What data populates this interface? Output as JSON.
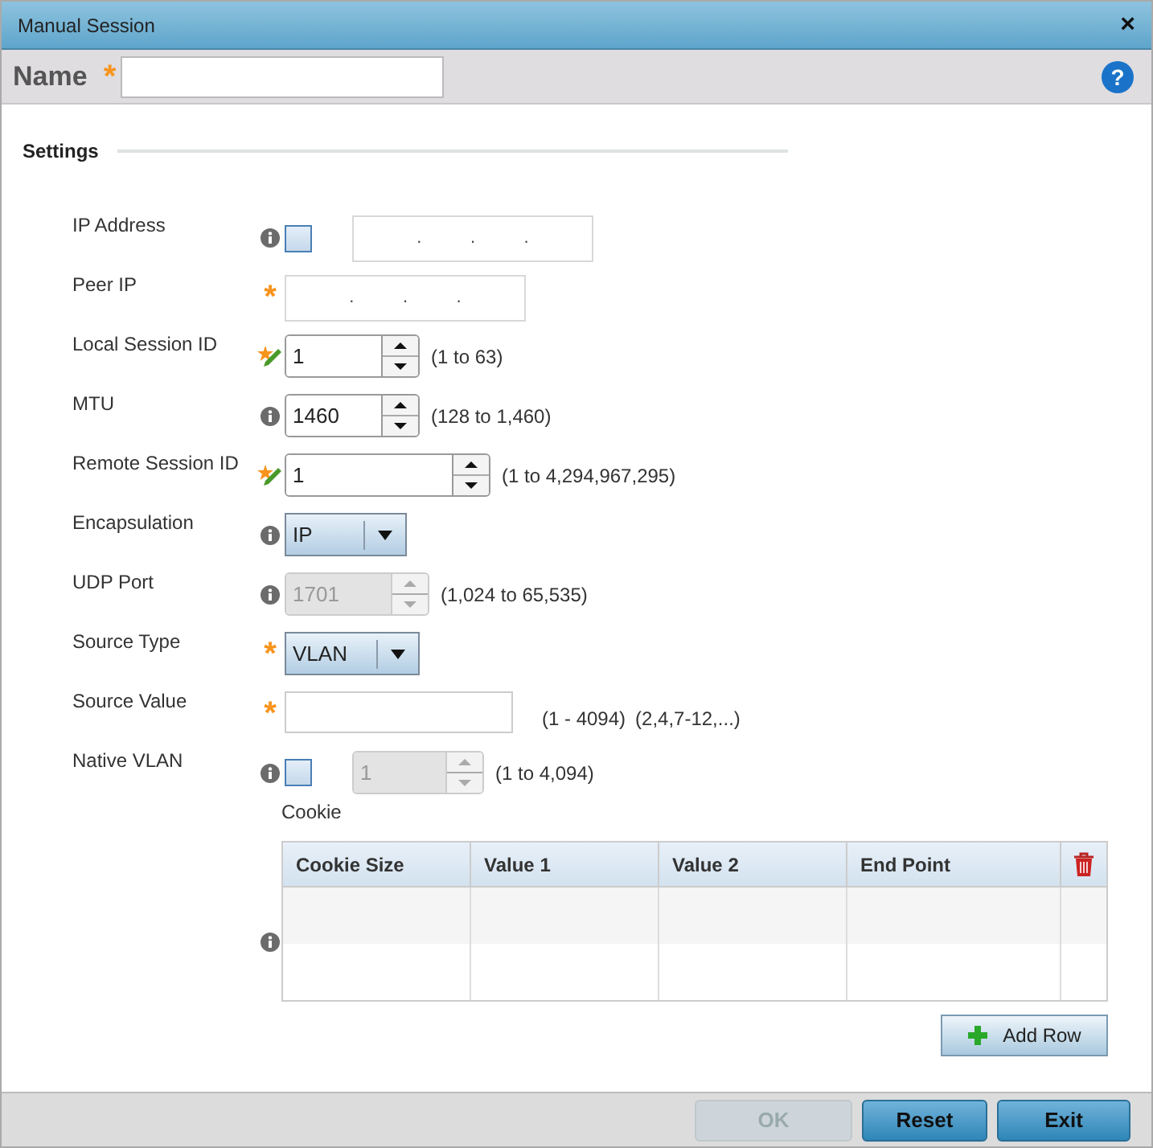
{
  "window": {
    "title": "Manual Session",
    "close": "×"
  },
  "name_field": {
    "label": "Name",
    "required_mark": "*"
  },
  "help": "?",
  "section": {
    "title": "Settings"
  },
  "rows": [
    {
      "label": "IP Address",
      "marker": {
        "kind": "info"
      },
      "kind": "ip",
      "checkbox": {
        "checked": false
      },
      "separators": [
        ".",
        ".",
        "."
      ],
      "disabled": false
    },
    {
      "label": "Peer IP",
      "marker": {
        "kind": "required",
        "mark": "*"
      },
      "kind": "ip",
      "separators": [
        ".",
        ".",
        "."
      ],
      "disabled": false
    },
    {
      "label": "Local Session ID",
      "marker": {
        "kind": "edited"
      },
      "kind": "spinner",
      "value": "1",
      "disabled": false,
      "hints": [
        "(1 to 63)"
      ]
    },
    {
      "label": "MTU",
      "marker": {
        "kind": "info"
      },
      "kind": "spinner",
      "value": "1460",
      "disabled": false,
      "hints": [
        "(128 to 1,460)"
      ]
    },
    {
      "label": "Remote Session ID",
      "marker": {
        "kind": "edited"
      },
      "kind": "spinner",
      "value": "1",
      "disabled": false,
      "hints": [
        "(1 to 4,294,967,295)"
      ]
    },
    {
      "label": "Encapsulation",
      "marker": {
        "kind": "info"
      },
      "kind": "select",
      "value": "IP",
      "disabled": false
    },
    {
      "label": "UDP Port",
      "marker": {
        "kind": "info"
      },
      "kind": "spinner",
      "value": "1701",
      "disabled": true,
      "hints": [
        "(1,024 to 65,535)"
      ]
    },
    {
      "label": "Source Type",
      "marker": {
        "kind": "required",
        "mark": "*"
      },
      "kind": "select",
      "value": "VLAN",
      "disabled": false
    },
    {
      "label": "Source Value",
      "marker": {
        "kind": "required",
        "mark": "*"
      },
      "kind": "text",
      "disabled": false,
      "hints": [
        "(1 - 4094)",
        "(2,4,7-12,...)"
      ]
    },
    {
      "label": "Native VLAN",
      "marker": {
        "kind": "info"
      },
      "kind": "spinner",
      "checkbox": {
        "checked": false
      },
      "value": "1",
      "disabled": true,
      "hints": [
        "(1 to 4,094)"
      ]
    }
  ],
  "cookie": {
    "label": "Cookie",
    "columns": [
      "Cookie Size",
      "Value 1",
      "Value 2",
      "End Point"
    ],
    "add_button": "Add Row"
  },
  "buttons": [
    {
      "label": "OK",
      "disabled": true
    },
    {
      "label": "Reset",
      "disabled": false
    },
    {
      "label": "Exit",
      "disabled": false
    }
  ]
}
